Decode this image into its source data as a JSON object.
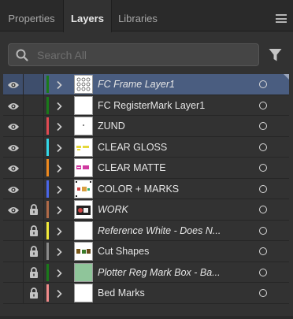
{
  "tabs": [
    {
      "label": "Properties"
    },
    {
      "label": "Layers"
    },
    {
      "label": "Libraries"
    }
  ],
  "search": {
    "placeholder": "Search All",
    "value": ""
  },
  "layers": [
    {
      "name": "FC Frame Layer1",
      "italic": true,
      "visible": true,
      "locked": false,
      "color": "#1a7a1a",
      "selected": true,
      "thumb": "frame"
    },
    {
      "name": "FC RegisterMark Layer1",
      "italic": false,
      "visible": true,
      "locked": false,
      "color": "#1a7a1a",
      "selected": false,
      "thumb": "blank"
    },
    {
      "name": "ZUND",
      "italic": false,
      "visible": true,
      "locked": false,
      "color": "#e04a52",
      "selected": false,
      "thumb": "dot"
    },
    {
      "name": "CLEAR GLOSS",
      "italic": false,
      "visible": true,
      "locked": false,
      "color": "#33d8e8",
      "selected": false,
      "thumb": "gloss"
    },
    {
      "name": "CLEAR MATTE",
      "italic": false,
      "visible": true,
      "locked": false,
      "color": "#ef8a1e",
      "selected": false,
      "thumb": "matte"
    },
    {
      "name": "COLOR + MARKS",
      "italic": false,
      "visible": true,
      "locked": false,
      "color": "#4a66e8",
      "selected": false,
      "thumb": "marks"
    },
    {
      "name": "WORK",
      "italic": true,
      "visible": true,
      "locked": true,
      "color": "#b06a48",
      "selected": false,
      "thumb": "work"
    },
    {
      "name": "Reference White - Does N...",
      "italic": true,
      "visible": false,
      "locked": true,
      "color": "#f2ea3a",
      "selected": false,
      "thumb": "blank"
    },
    {
      "name": "Cut Shapes",
      "italic": false,
      "visible": false,
      "locked": true,
      "color": "#8a8a8a",
      "selected": false,
      "thumb": "cut"
    },
    {
      "name": "Plotter Reg Mark Box - Ba...",
      "italic": true,
      "visible": false,
      "locked": true,
      "color": "#1a7a1a",
      "selected": false,
      "thumb": "green"
    },
    {
      "name": "Bed Marks",
      "italic": false,
      "visible": false,
      "locked": true,
      "color": "#f08a8a",
      "selected": false,
      "thumb": "blank"
    }
  ]
}
